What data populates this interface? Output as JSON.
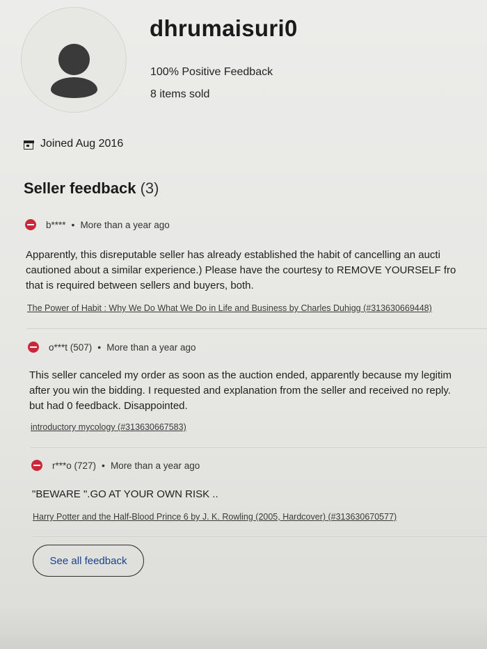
{
  "profile": {
    "username": "dhrumaisuri0",
    "positive_feedback": "100% Positive Feedback",
    "items_sold": "8 items sold",
    "joined": "Joined Aug 2016",
    "avatar_icon": "user-silhouette-icon"
  },
  "feedback_section": {
    "title": "Seller feedback",
    "count": "(3)",
    "entries": [
      {
        "user": "b****",
        "time": "More than a year ago",
        "rating_icon": "negative-rating-icon",
        "text_lines": [
          "Apparently, this disreputable seller has already established the habit of cancelling an aucti",
          "cautioned about a similar experience.) Please have the courtesy to REMOVE YOURSELF fro",
          "that is required between sellers and buyers, both."
        ],
        "item": "The Power of Habit : Why We Do What We Do in Life and Business by Charles Duhigg (#313630669448)"
      },
      {
        "user": "o***t (507)",
        "time": "More than a year ago",
        "rating_icon": "negative-rating-icon",
        "text_lines": [
          "This seller canceled my order as soon as the auction ended, apparently because my legitim",
          "after you win the bidding. I requested and explanation from the seller and received no reply.",
          "but had 0 feedback. Disappointed."
        ],
        "item": "introductory mycology (#313630667583)"
      },
      {
        "user": "r***o (727)",
        "time": "More than a year ago",
        "rating_icon": "negative-rating-icon",
        "text_lines": [
          "\"BEWARE \".GO AT YOUR OWN RISK .."
        ],
        "item": "Harry Potter and the Half-Blood Prince 6 by J. K. Rowling (2005, Hardcover) (#313630670577)"
      }
    ],
    "separator": "•",
    "see_all_label": "See all feedback"
  },
  "colors": {
    "negative": "#c8283a",
    "link_blue": "#1d3f8e",
    "background": "#e9e9e6"
  }
}
